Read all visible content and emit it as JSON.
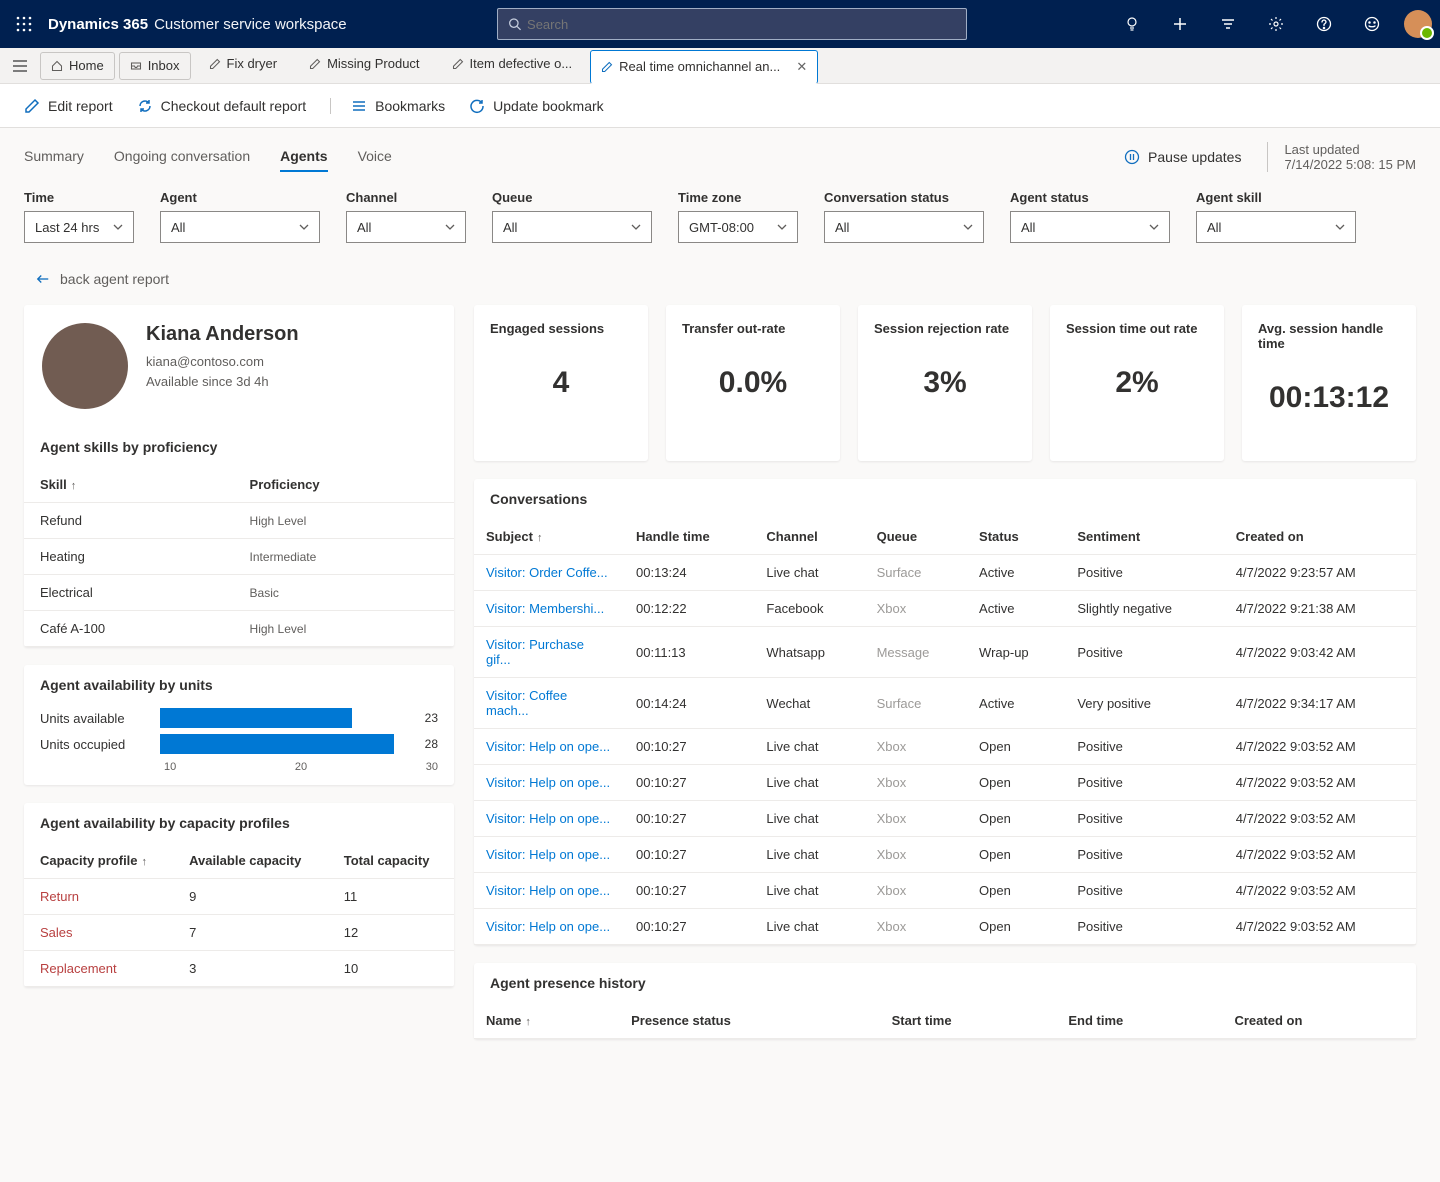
{
  "app": {
    "brand": "Dynamics 365",
    "subtitle": "Customer service workspace",
    "search_placeholder": "Search"
  },
  "tabs": {
    "home": "Home",
    "inbox": "Inbox",
    "items": [
      "Fix dryer",
      "Missing Product",
      "Item defective o...",
      "Real time omnichannel an..."
    ]
  },
  "toolbar": {
    "edit": "Edit report",
    "checkout": "Checkout default report",
    "bookmarks": "Bookmarks",
    "update": "Update bookmark"
  },
  "viewTabs": [
    "Summary",
    "Ongoing conversation",
    "Agents",
    "Voice"
  ],
  "viewTabActive": "Agents",
  "pause": "Pause updates",
  "lastUpdated": {
    "label": "Last updated",
    "value": "7/14/2022 5:08: 15 PM"
  },
  "filters": [
    {
      "label": "Time",
      "value": "Last 24 hrs"
    },
    {
      "label": "Agent",
      "value": "All"
    },
    {
      "label": "Channel",
      "value": "All"
    },
    {
      "label": "Queue",
      "value": "All"
    },
    {
      "label": "Time zone",
      "value": "GMT-08:00"
    },
    {
      "label": "Conversation status",
      "value": "All"
    },
    {
      "label": "Agent status",
      "value": "All"
    },
    {
      "label": "Agent skill",
      "value": "All"
    }
  ],
  "back": "back agent report",
  "agent": {
    "name": "Kiana Anderson",
    "email": "kiana@contoso.com",
    "availability": "Available since 3d 4h"
  },
  "skillsTitle": "Agent skills by proficiency",
  "skillsCols": {
    "skill": "Skill",
    "prof": "Proficiency"
  },
  "skills": [
    {
      "name": "Refund",
      "level": "High Level"
    },
    {
      "name": "Heating",
      "level": "Intermediate"
    },
    {
      "name": "Electrical",
      "level": "Basic"
    },
    {
      "name": "Café A-100",
      "level": "High Level"
    }
  ],
  "availUnitsTitle": "Agent availability by units",
  "chart_data": {
    "type": "bar",
    "orientation": "horizontal",
    "categories": [
      "Units available",
      "Units occupied"
    ],
    "values": [
      23,
      28
    ],
    "xlim": [
      0,
      30
    ],
    "ticks": [
      10,
      20,
      30
    ]
  },
  "capTitle": "Agent availability by capacity profiles",
  "capCols": {
    "profile": "Capacity profile",
    "avail": "Available capacity",
    "total": "Total capacity"
  },
  "capacity": [
    {
      "name": "Return",
      "avail": "9",
      "total": "11"
    },
    {
      "name": "Sales",
      "avail": "7",
      "total": "12"
    },
    {
      "name": "Replacement",
      "avail": "3",
      "total": "10"
    }
  ],
  "kpis": [
    {
      "title": "Engaged sessions",
      "value": "4"
    },
    {
      "title": "Transfer out-rate",
      "value": "0.0%"
    },
    {
      "title": "Session rejection rate",
      "value": "3%"
    },
    {
      "title": "Session time out rate",
      "value": "2%"
    },
    {
      "title": "Avg. session handle time",
      "value": "00:13:12"
    }
  ],
  "convTitle": "Conversations",
  "convCols": {
    "subject": "Subject",
    "handle": "Handle time",
    "channel": "Channel",
    "queue": "Queue",
    "status": "Status",
    "sent": "Sentiment",
    "created": "Created on"
  },
  "conversations": [
    {
      "subject": "Visitor: Order Coffe...",
      "handle": "00:13:24",
      "channel": "Live chat",
      "queue": "Surface",
      "status": "Active",
      "sent": "Positive",
      "created": "4/7/2022 9:23:57 AM"
    },
    {
      "subject": "Visitor: Membershi...",
      "handle": "00:12:22",
      "channel": "Facebook",
      "queue": "Xbox",
      "status": "Active",
      "sent": "Slightly negative",
      "created": "4/7/2022 9:21:38 AM"
    },
    {
      "subject": "Visitor: Purchase gif...",
      "handle": "00:11:13",
      "channel": "Whatsapp",
      "queue": "Message",
      "status": "Wrap-up",
      "sent": "Positive",
      "created": "4/7/2022 9:03:42 AM"
    },
    {
      "subject": "Visitor: Coffee mach...",
      "handle": "00:14:24",
      "channel": "Wechat",
      "queue": "Surface",
      "status": "Active",
      "sent": "Very positive",
      "created": "4/7/2022 9:34:17 AM"
    },
    {
      "subject": "Visitor: Help on ope...",
      "handle": "00:10:27",
      "channel": "Live chat",
      "queue": "Xbox",
      "status": "Open",
      "sent": "Positive",
      "created": "4/7/2022 9:03:52 AM"
    },
    {
      "subject": "Visitor: Help on ope...",
      "handle": "00:10:27",
      "channel": "Live chat",
      "queue": "Xbox",
      "status": "Open",
      "sent": "Positive",
      "created": "4/7/2022 9:03:52 AM"
    },
    {
      "subject": "Visitor: Help on ope...",
      "handle": "00:10:27",
      "channel": "Live chat",
      "queue": "Xbox",
      "status": "Open",
      "sent": "Positive",
      "created": "4/7/2022 9:03:52 AM"
    },
    {
      "subject": "Visitor: Help on ope...",
      "handle": "00:10:27",
      "channel": "Live chat",
      "queue": "Xbox",
      "status": "Open",
      "sent": "Positive",
      "created": "4/7/2022 9:03:52 AM"
    },
    {
      "subject": "Visitor: Help on ope...",
      "handle": "00:10:27",
      "channel": "Live chat",
      "queue": "Xbox",
      "status": "Open",
      "sent": "Positive",
      "created": "4/7/2022 9:03:52 AM"
    },
    {
      "subject": "Visitor: Help on ope...",
      "handle": "00:10:27",
      "channel": "Live chat",
      "queue": "Xbox",
      "status": "Open",
      "sent": "Positive",
      "created": "4/7/2022 9:03:52 AM"
    }
  ],
  "presenceTitle": "Agent presence history",
  "presenceCols": {
    "name": "Name",
    "status": "Presence status",
    "start": "Start time",
    "end": "End time",
    "created": "Created on"
  }
}
